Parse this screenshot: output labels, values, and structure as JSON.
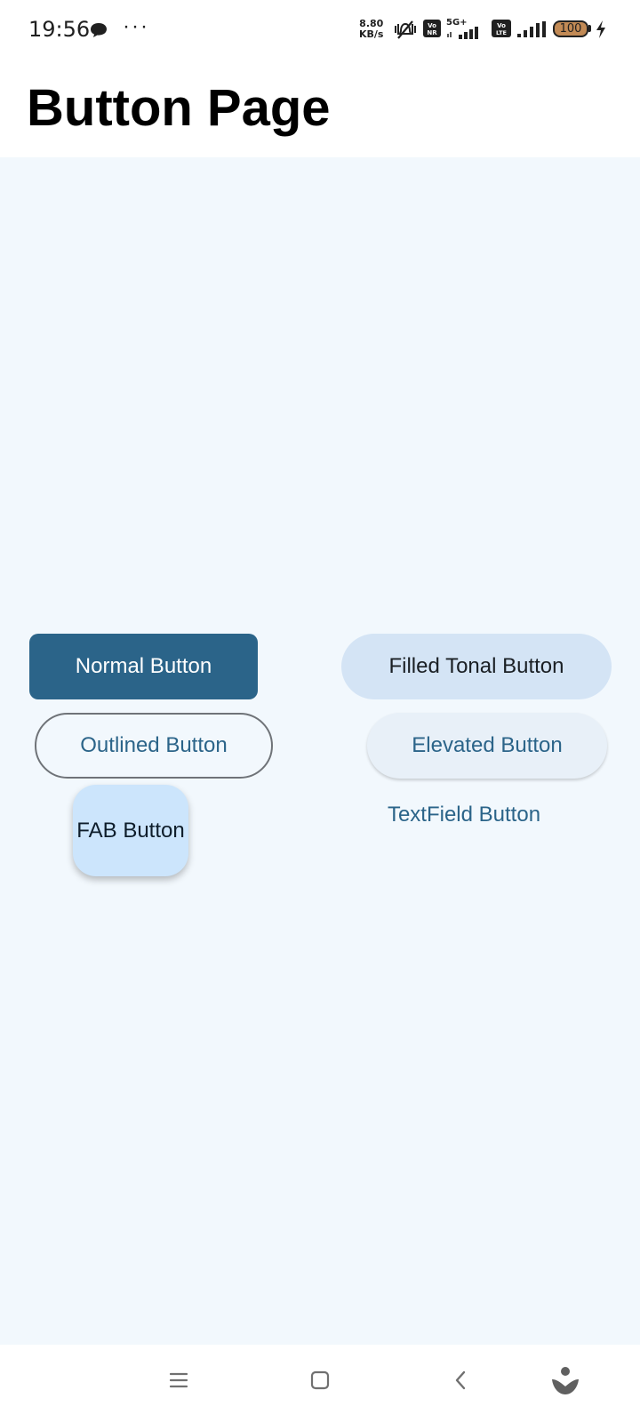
{
  "status_bar": {
    "time": "19:56",
    "more": "···",
    "net_speed_value": "8.80",
    "net_speed_unit": "KB/s",
    "network_label": "5G+",
    "battery_level": "100",
    "icons": [
      "message-icon",
      "vibrate-off-icon",
      "vonr-icon",
      "signal-icon",
      "volte-icon",
      "signal-icon",
      "battery-icon",
      "charging-icon"
    ]
  },
  "header": {
    "title": "Button Page"
  },
  "buttons": {
    "normal": "Normal Button",
    "filled_tonal": "Filled Tonal Button",
    "outlined": "Outlined Button",
    "elevated": "Elevated Button",
    "fab": "FAB Button",
    "text": "TextField Button"
  },
  "nav_bar": {
    "icons": [
      "menu-icon",
      "home-icon",
      "back-icon",
      "assistant-icon"
    ]
  },
  "colors": {
    "primary": "#2b6489",
    "background": "#f2f8fd",
    "tonal": "#d4e4f5",
    "fab": "#cce5fc"
  }
}
